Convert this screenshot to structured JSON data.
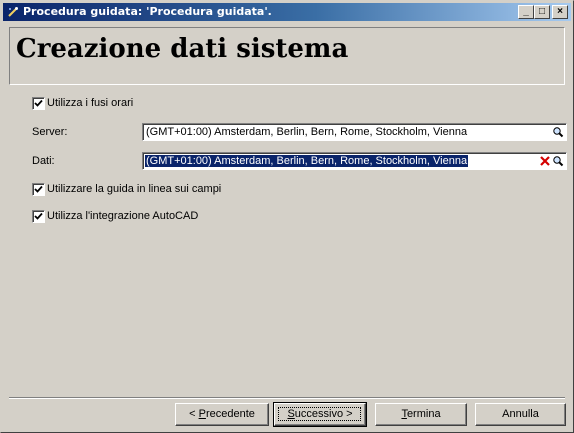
{
  "window": {
    "title": "Procedura guidata: 'Procedura guidata'.",
    "controls": {
      "minimize": "_",
      "maximize": "□",
      "close": "×"
    }
  },
  "header": {
    "title": "Creazione dati sistema"
  },
  "options": {
    "use_timezones": {
      "label": "Utilizza i fusi orari",
      "checked": true
    },
    "online_help": {
      "label": "Utilizzare la guida in linea sui campi",
      "checked": true
    },
    "autocad": {
      "label": "Utilizza l'integrazione AutoCAD",
      "checked": true
    }
  },
  "fields": {
    "server": {
      "label": "Server:",
      "value": "(GMT+01:00) Amsterdam, Berlin, Bern, Rome, Stockholm, Vienna"
    },
    "data": {
      "label": "Dati:",
      "value": "(GMT+01:00) Amsterdam, Berlin, Bern, Rome, Stockholm, Vienna"
    }
  },
  "buttons": {
    "previous": {
      "label_pre": "< ",
      "accel": "P",
      "label_post": "recedente"
    },
    "next": {
      "accel": "S",
      "label_post": "uccessivo >"
    },
    "finish": {
      "accel": "T",
      "label_post": "ermina"
    },
    "cancel": {
      "label": "Annulla"
    }
  },
  "colors": {
    "selection": "#0a246a",
    "face": "#d4d0c8",
    "clear_x": "#d40000"
  }
}
